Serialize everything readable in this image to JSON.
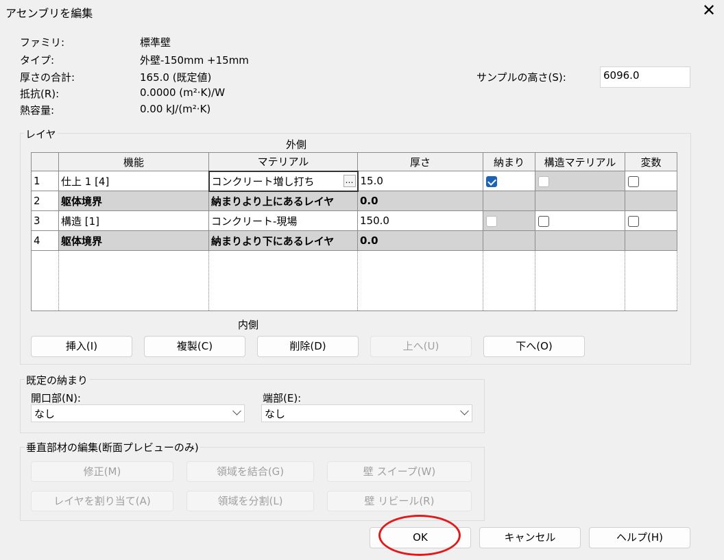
{
  "window": {
    "title": "アセンブリを編集",
    "close": "✕"
  },
  "props": [
    {
      "label": "ファミリ:",
      "value": "標準壁"
    },
    {
      "label": "タイプ:",
      "value": "外壁-150mm +15mm"
    },
    {
      "label": "厚さの合計:",
      "value": "165.0 (既定値)"
    },
    {
      "label": "抵抗(R):",
      "value": "0.0000 (m²·K)/W"
    },
    {
      "label": "熱容量:",
      "value": "0.00 kJ/(m²·K)"
    }
  ],
  "sample": {
    "label": "サンプルの高さ(S):",
    "value": "6096.0"
  },
  "layers": {
    "title": "レイヤ",
    "outer": "外側",
    "inner": "内側",
    "headers": [
      "機能",
      "マテリアル",
      "厚さ",
      "納まり",
      "構造マテリアル",
      "変数"
    ],
    "rows": [
      {
        "num": "1",
        "func": "仕上 1 [4]",
        "material": "コンクリート増し打ち",
        "thick": "15.0"
      },
      {
        "num": "2",
        "func": "躯体境界",
        "material": "納まりより上にあるレイヤ",
        "thick": "0.0"
      },
      {
        "num": "3",
        "func": "構造 [1]",
        "material": "コンクリート-現場",
        "thick": "150.0"
      },
      {
        "num": "4",
        "func": "躯体境界",
        "material": "納まりより下にあるレイヤ",
        "thick": "0.0"
      }
    ],
    "buttons": {
      "insert": "挿入(I)",
      "duplicate": "複製(C)",
      "delete": "削除(D)",
      "up": "上へ(U)",
      "down": "下へ(O)"
    }
  },
  "wrap": {
    "title": "既定の納まり",
    "opening_label": "開口部(N):",
    "opening_value": "なし",
    "end_label": "端部(E):",
    "end_value": "なし"
  },
  "vertical": {
    "title": "垂直部材の編集(断面プレビューのみ)",
    "buttons": {
      "modify": "修正(M)",
      "merge": "領域を結合(G)",
      "sweep": "壁 スイープ(W)",
      "assign": "レイヤを割り当て(A)",
      "split": "領域を分割(L)",
      "reveal": "壁 リビール(R)"
    }
  },
  "footer": {
    "ok": "OK",
    "cancel": "キャンセル",
    "help": "ヘルプ(H)"
  },
  "colors": {
    "highlight_ring": "#e01b1b",
    "checkbox_on": "#1a63b8",
    "gray_cell": "#d4d4d4"
  }
}
